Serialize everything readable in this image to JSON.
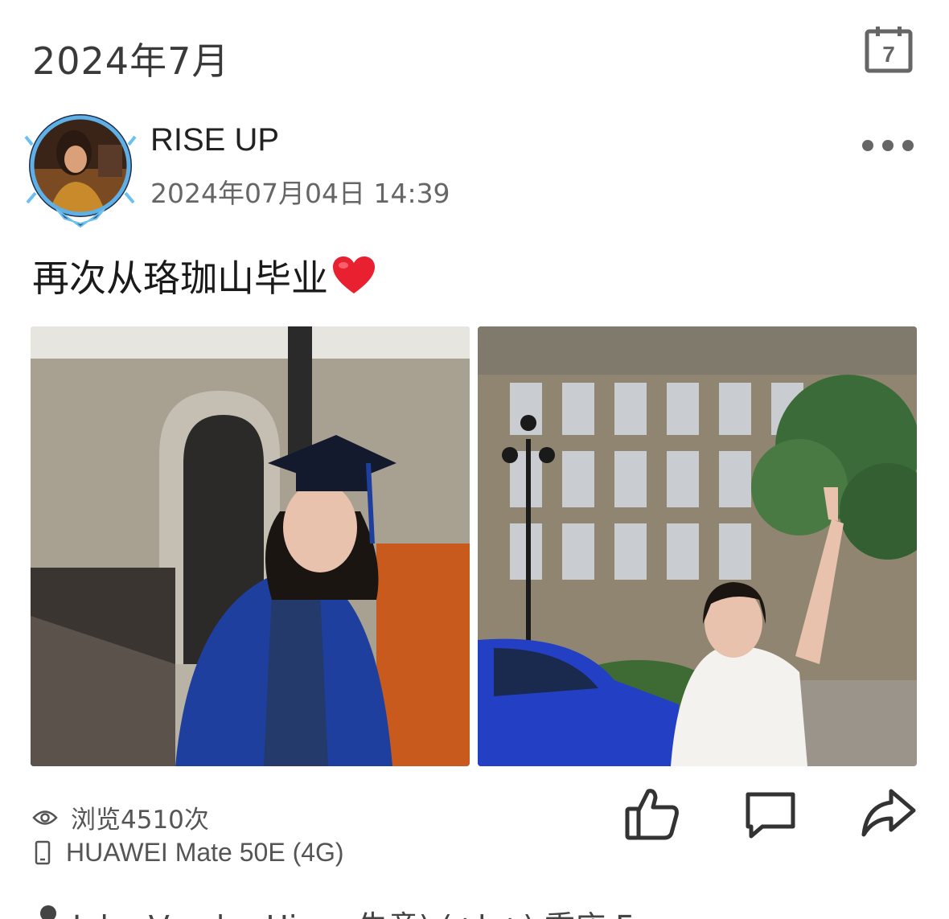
{
  "header": {
    "month": "2024年7月",
    "calendar_day": "7"
  },
  "post": {
    "username": "RISE UP",
    "timestamp": "2024年07月04日 14:39",
    "caption": "再次从珞珈山毕业",
    "photos": [
      {
        "subject": "graduation-gown-photo"
      },
      {
        "subject": "campus-building-photo"
      }
    ],
    "views": "浏览4510次",
    "device": "HUAWEI Mate 50E (4G)"
  },
  "next_entry": {
    "partial_text": "John Vander Hiner 失意) (+b+)    重庆 Fro"
  },
  "colors": {
    "text_primary": "#222222",
    "text_secondary": "#666666",
    "heart": "#e8202f",
    "gown_blue": "#1f3f9e"
  }
}
